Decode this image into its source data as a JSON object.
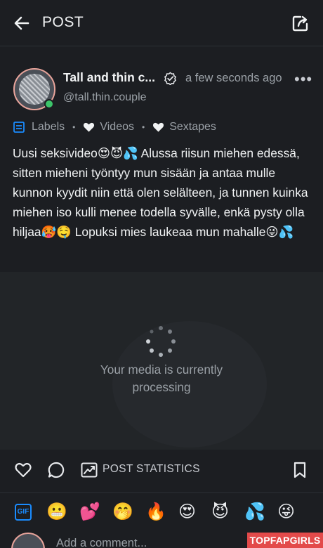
{
  "header": {
    "title": "POST"
  },
  "post": {
    "author_name": "Tall and thin c...",
    "timestamp": "a few seconds ago",
    "handle": "@tall.thin.couple",
    "labels": {
      "title": "Labels",
      "items": [
        "Videos",
        "Sextapes"
      ]
    },
    "text": "Uusi seksivideo😍😈💦 Alussa riisun miehen edessä, sitten mieheni työntyy mun sisään ja antaa mulle kunnon kyydit niin että olen selälteen, ja tunnen kuinka miehen iso kulli menee todella syvälle, enkä pysty olla hiljaa🥵🤤 Lopuksi mies laukeaa mun mahalle😜💦"
  },
  "media": {
    "status": "Your media is currently processing"
  },
  "actions": {
    "stats_label": "POST STATISTICS"
  },
  "emoji_bar": {
    "gif_label": "GIF",
    "emojis": [
      "😬",
      "💕",
      "🤭",
      "🔥",
      "😍",
      "😈",
      "💦",
      "😜"
    ]
  },
  "comment": {
    "placeholder": "Add a comment..."
  },
  "watermark": "TOPFAPGIRLS",
  "colors": {
    "background": "#1c1e22",
    "accent": "#1a8cff",
    "online": "#3cc46a",
    "muted_text": "#9aa0a6"
  },
  "icons": [
    "back-arrow-icon",
    "share-icon",
    "verified-icon",
    "more-icon",
    "labels-icon",
    "heart-icon",
    "comment-icon",
    "stats-icon",
    "bookmark-icon",
    "gif-icon",
    "spinner-icon"
  ]
}
